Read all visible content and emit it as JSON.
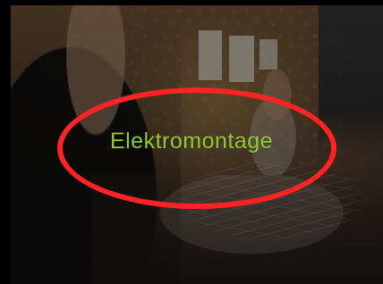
{
  "tile": {
    "title": "Elektromontage",
    "title_color": "#8fcb2f",
    "highlight_color": "#ff2424"
  }
}
